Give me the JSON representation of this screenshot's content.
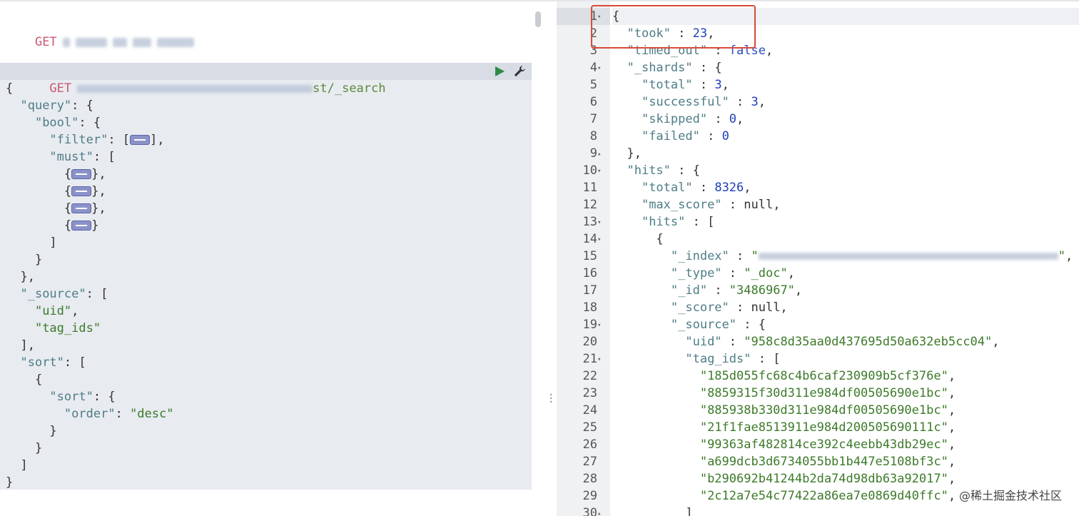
{
  "request_1": {
    "method": "GET"
  },
  "request_2": {
    "method": "GET",
    "path_suffix": "st/_search"
  },
  "request_body": [
    [
      [
        "p",
        "{"
      ]
    ],
    [
      [
        "p",
        "  "
      ],
      [
        "k",
        "\"query\""
      ],
      [
        "p",
        ": {"
      ]
    ],
    [
      [
        "p",
        "    "
      ],
      [
        "k",
        "\"bool\""
      ],
      [
        "p",
        ": {"
      ]
    ],
    [
      [
        "p",
        "      "
      ],
      [
        "k",
        "\"filter\""
      ],
      [
        "p",
        ": ["
      ],
      [
        "f",
        ""
      ],
      [
        "p",
        "],"
      ]
    ],
    [
      [
        "p",
        "      "
      ],
      [
        "k",
        "\"must\""
      ],
      [
        "p",
        ": ["
      ]
    ],
    [
      [
        "p",
        "        {"
      ],
      [
        "f",
        ""
      ],
      [
        "p",
        "},"
      ]
    ],
    [
      [
        "p",
        "        {"
      ],
      [
        "f",
        ""
      ],
      [
        "p",
        "},"
      ]
    ],
    [
      [
        "p",
        "        {"
      ],
      [
        "f",
        ""
      ],
      [
        "p",
        "},"
      ]
    ],
    [
      [
        "p",
        "        {"
      ],
      [
        "f",
        ""
      ],
      [
        "p",
        "}"
      ]
    ],
    [
      [
        "p",
        "      ]"
      ]
    ],
    [
      [
        "p",
        "    }"
      ]
    ],
    [
      [
        "p",
        "  },"
      ]
    ],
    [
      [
        "p",
        "  "
      ],
      [
        "k",
        "\"_source\""
      ],
      [
        "p",
        ": ["
      ]
    ],
    [
      [
        "p",
        "    "
      ],
      [
        "s",
        "\"uid\""
      ],
      [
        "p",
        ","
      ]
    ],
    [
      [
        "p",
        "    "
      ],
      [
        "s",
        "\"tag_ids\""
      ]
    ],
    [
      [
        "p",
        "  ],"
      ]
    ],
    [
      [
        "p",
        "  "
      ],
      [
        "k",
        "\"sort\""
      ],
      [
        "p",
        ": ["
      ]
    ],
    [
      [
        "p",
        "    {"
      ]
    ],
    [
      [
        "p",
        "      "
      ],
      [
        "k",
        "\"sort\""
      ],
      [
        "p",
        ": {"
      ]
    ],
    [
      [
        "p",
        "        "
      ],
      [
        "k",
        "\"order\""
      ],
      [
        "p",
        ": "
      ],
      [
        "s",
        "\"desc\""
      ]
    ],
    [
      [
        "p",
        "      }"
      ]
    ],
    [
      [
        "p",
        "    }"
      ]
    ],
    [
      [
        "p",
        "  ]"
      ]
    ],
    [
      [
        "p",
        "}"
      ]
    ]
  ],
  "response": {
    "lines": [
      {
        "n": "1",
        "fold": "▾",
        "parts": [
          [
            "p",
            "{"
          ]
        ]
      },
      {
        "n": "2",
        "fold": "",
        "parts": [
          [
            "p",
            "  "
          ],
          [
            "k",
            "\"took\""
          ],
          [
            "p",
            " : "
          ],
          [
            "n",
            "23"
          ],
          [
            "p",
            ","
          ]
        ]
      },
      {
        "n": "3",
        "fold": "",
        "parts": [
          [
            "p",
            "  "
          ],
          [
            "k",
            "\"timed_out\""
          ],
          [
            "p",
            " : "
          ],
          [
            "b",
            "false"
          ],
          [
            "p",
            ","
          ]
        ]
      },
      {
        "n": "4",
        "fold": "▾",
        "parts": [
          [
            "p",
            "  "
          ],
          [
            "k",
            "\"_shards\""
          ],
          [
            "p",
            " : {"
          ]
        ]
      },
      {
        "n": "5",
        "fold": "",
        "parts": [
          [
            "p",
            "    "
          ],
          [
            "k",
            "\"total\""
          ],
          [
            "p",
            " : "
          ],
          [
            "n",
            "3"
          ],
          [
            "p",
            ","
          ]
        ]
      },
      {
        "n": "6",
        "fold": "",
        "parts": [
          [
            "p",
            "    "
          ],
          [
            "k",
            "\"successful\""
          ],
          [
            "p",
            " : "
          ],
          [
            "n",
            "3"
          ],
          [
            "p",
            ","
          ]
        ]
      },
      {
        "n": "7",
        "fold": "",
        "parts": [
          [
            "p",
            "    "
          ],
          [
            "k",
            "\"skipped\""
          ],
          [
            "p",
            " : "
          ],
          [
            "n",
            "0"
          ],
          [
            "p",
            ","
          ]
        ]
      },
      {
        "n": "8",
        "fold": "",
        "parts": [
          [
            "p",
            "    "
          ],
          [
            "k",
            "\"failed\""
          ],
          [
            "p",
            " : "
          ],
          [
            "n",
            "0"
          ]
        ]
      },
      {
        "n": "9",
        "fold": "▴",
        "parts": [
          [
            "p",
            "  },"
          ]
        ]
      },
      {
        "n": "10",
        "fold": "▾",
        "parts": [
          [
            "p",
            "  "
          ],
          [
            "k",
            "\"hits\""
          ],
          [
            "p",
            " : {"
          ]
        ]
      },
      {
        "n": "11",
        "fold": "",
        "parts": [
          [
            "p",
            "    "
          ],
          [
            "k",
            "\"total\""
          ],
          [
            "p",
            " : "
          ],
          [
            "n",
            "8326"
          ],
          [
            "p",
            ","
          ]
        ]
      },
      {
        "n": "12",
        "fold": "",
        "parts": [
          [
            "p",
            "    "
          ],
          [
            "k",
            "\"max_score\""
          ],
          [
            "p",
            " : null,"
          ]
        ]
      },
      {
        "n": "13",
        "fold": "▾",
        "parts": [
          [
            "p",
            "    "
          ],
          [
            "k",
            "\"hits\""
          ],
          [
            "p",
            " : ["
          ]
        ]
      },
      {
        "n": "14",
        "fold": "▾",
        "parts": [
          [
            "p",
            "      {"
          ]
        ]
      },
      {
        "n": "15",
        "fold": "",
        "parts": [
          [
            "p",
            "        "
          ],
          [
            "k",
            "\"_index\""
          ],
          [
            "p",
            " : "
          ],
          [
            "v",
            "\""
          ],
          [
            "x",
            ""
          ],
          [
            "v",
            "\""
          ],
          [
            "p",
            ","
          ]
        ]
      },
      {
        "n": "16",
        "fold": "",
        "parts": [
          [
            "p",
            "        "
          ],
          [
            "k",
            "\"_type\""
          ],
          [
            "p",
            " : "
          ],
          [
            "v",
            "\"_doc\""
          ],
          [
            "p",
            ","
          ]
        ]
      },
      {
        "n": "17",
        "fold": "",
        "parts": [
          [
            "p",
            "        "
          ],
          [
            "k",
            "\"_id\""
          ],
          [
            "p",
            " : "
          ],
          [
            "v",
            "\"3486967\""
          ],
          [
            "p",
            ","
          ]
        ]
      },
      {
        "n": "18",
        "fold": "",
        "parts": [
          [
            "p",
            "        "
          ],
          [
            "k",
            "\"_score\""
          ],
          [
            "p",
            " : null,"
          ]
        ]
      },
      {
        "n": "19",
        "fold": "▾",
        "parts": [
          [
            "p",
            "        "
          ],
          [
            "k",
            "\"_source\""
          ],
          [
            "p",
            " : {"
          ]
        ]
      },
      {
        "n": "20",
        "fold": "",
        "parts": [
          [
            "p",
            "          "
          ],
          [
            "k",
            "\"uid\""
          ],
          [
            "p",
            " : "
          ],
          [
            "v",
            "\"958c8d35aa0d437695d50a632eb5cc04\""
          ],
          [
            "p",
            ","
          ]
        ]
      },
      {
        "n": "21",
        "fold": "▾",
        "parts": [
          [
            "p",
            "          "
          ],
          [
            "k",
            "\"tag_ids\""
          ],
          [
            "p",
            " : ["
          ]
        ]
      },
      {
        "n": "22",
        "fold": "",
        "parts": [
          [
            "p",
            "            "
          ],
          [
            "v",
            "\"185d055fc68c4b6caf230909b5cf376e\""
          ],
          [
            "p",
            ","
          ]
        ]
      },
      {
        "n": "23",
        "fold": "",
        "parts": [
          [
            "p",
            "            "
          ],
          [
            "v",
            "\"8859315f30d311e984df00505690e1bc\""
          ],
          [
            "p",
            ","
          ]
        ]
      },
      {
        "n": "24",
        "fold": "",
        "parts": [
          [
            "p",
            "            "
          ],
          [
            "v",
            "\"885938b330d311e984df00505690e1bc\""
          ],
          [
            "p",
            ","
          ]
        ]
      },
      {
        "n": "25",
        "fold": "",
        "parts": [
          [
            "p",
            "            "
          ],
          [
            "v",
            "\"21f1fae8513911e984d200505690111c\""
          ],
          [
            "p",
            ","
          ]
        ]
      },
      {
        "n": "26",
        "fold": "",
        "parts": [
          [
            "p",
            "            "
          ],
          [
            "v",
            "\"99363af482814ce392c4eebb43db29ec\""
          ],
          [
            "p",
            ","
          ]
        ]
      },
      {
        "n": "27",
        "fold": "",
        "parts": [
          [
            "p",
            "            "
          ],
          [
            "v",
            "\"a699dcb3d6734055bb1b447e5108bf3c\""
          ],
          [
            "p",
            ","
          ]
        ]
      },
      {
        "n": "28",
        "fold": "",
        "parts": [
          [
            "p",
            "            "
          ],
          [
            "v",
            "\"b290692b41244b2da74d98db63a92017\""
          ],
          [
            "p",
            ","
          ]
        ]
      },
      {
        "n": "29",
        "fold": "",
        "parts": [
          [
            "p",
            "            "
          ],
          [
            "v",
            "\"2c12a7e54c77422a86ea7e0869d40ffc\""
          ],
          [
            "p",
            ","
          ]
        ]
      },
      {
        "n": "30",
        "fold": "▴",
        "parts": [
          [
            "p",
            "          ]"
          ]
        ]
      }
    ]
  },
  "watermark": "@稀土掘金技术社区"
}
